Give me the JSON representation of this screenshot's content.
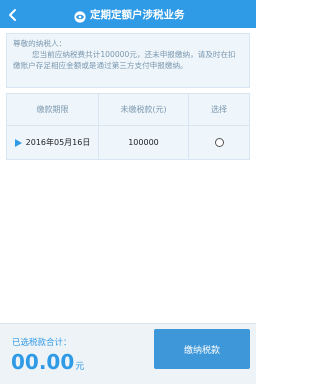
{
  "header": {
    "title": "定期定额户涉税业务",
    "background": "#2f9ae6"
  },
  "notice": {
    "greeting": "尊敬的纳税人：",
    "body": "您当前应纳税费共计100000元，还未申报缴纳，请及时在扣缴账户存足相应金额或是通过第三方支付申报缴纳。"
  },
  "table": {
    "headers": [
      "缴款期限",
      "未缴税款(元)",
      "选择"
    ],
    "rows": [
      {
        "deadline": "2016年05月16日",
        "amount": "100000",
        "selected": false
      }
    ]
  },
  "footer": {
    "total_label": "已选税款合计：",
    "total_value": "00.00",
    "total_unit": "元",
    "pay_button_label": "缴纳税款",
    "accent": "#2f9ae6"
  },
  "icons": {
    "back": "chevron-left-icon",
    "title": "eye-icon",
    "row": "triangle-right-icon"
  }
}
